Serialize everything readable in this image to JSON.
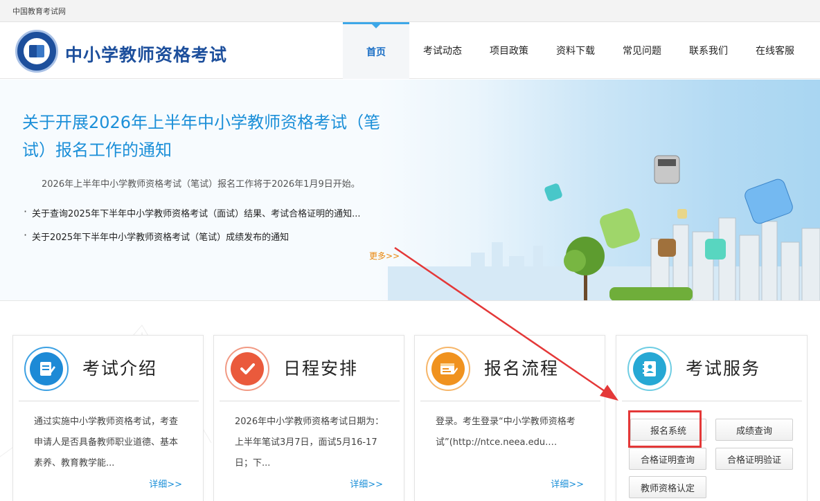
{
  "topbar": {
    "site_label": "中国教育考试网"
  },
  "header": {
    "logo_title": "中小学教师资格考试",
    "nav": [
      {
        "label": "首页",
        "active": true
      },
      {
        "label": "考试动态",
        "active": false
      },
      {
        "label": "项目政策",
        "active": false
      },
      {
        "label": "资料下载",
        "active": false
      },
      {
        "label": "常见问题",
        "active": false
      },
      {
        "label": "联系我们",
        "active": false
      },
      {
        "label": "在线客服",
        "active": false
      }
    ]
  },
  "banner": {
    "headline": "关于开展2026年上半年中小学教师资格考试（笔试）报名工作的通知",
    "lead": "2026年上半年中小学教师资格考试（笔试）报名工作将于2026年1月9日开始。",
    "news": [
      "关于查询2025年下半年中小学教师资格考试（面试）结果、考试合格证明的通知...",
      "关于2025年下半年中小学教师资格考试（笔试）成绩发布的通知"
    ],
    "more": "更多>>"
  },
  "cards": [
    {
      "title": "考试介绍",
      "icon": "exam-intro-icon",
      "body": "通过实施中小学教师资格考试，考查申请人是否具备教师职业道德、基本素养、教育教学能...",
      "more": "详细>>"
    },
    {
      "title": "日程安排",
      "icon": "schedule-check-icon",
      "body": "2026年中小学教师资格考试日期为：上半年笔试3月7日，面试5月16-17日；下...",
      "more": "详细>>"
    },
    {
      "title": "报名流程",
      "icon": "registration-flow-icon",
      "body": "登录。考生登录“中小学教师资格考试”(http://ntce.neea.edu.…",
      "more": "详细>>"
    },
    {
      "title": "考试服务",
      "icon": "exam-service-icon"
    }
  ],
  "services": {
    "registration": "报名系统",
    "score_query": "成绩查询",
    "certificate_query": "合格证明查询",
    "certificate_verify": "合格证明验证",
    "qualification": "教师资格认定"
  },
  "colors": {
    "brand": "#1d4f9c",
    "accent": "#1b8fd8",
    "orange": "#e9860c",
    "annotation": "#e43838"
  }
}
